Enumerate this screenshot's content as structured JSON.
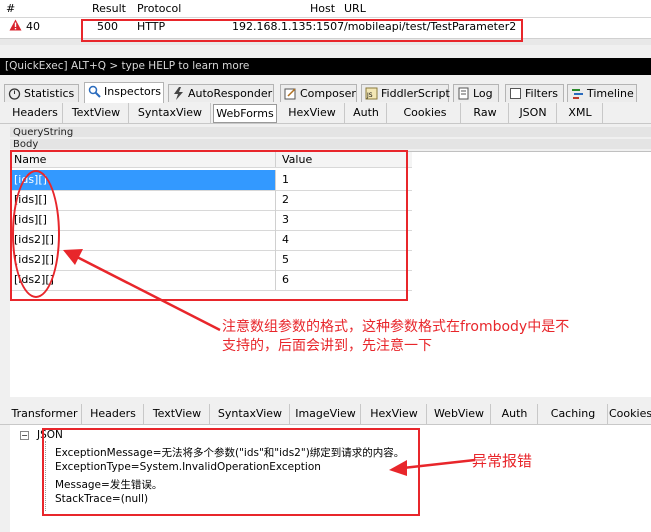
{
  "sessions": {
    "headers": [
      "#",
      "Result",
      "Protocol",
      "Host",
      "URL"
    ],
    "row": {
      "id": "40",
      "result": "500",
      "protocol": "HTTP",
      "host": "192.168.1.135:1507",
      "url": "/mobileapi/test/TestParameter2"
    }
  },
  "quickexec": {
    "placeholder": "[QuickExec] ALT+Q > type HELP to learn more"
  },
  "main_tabs": [
    "Statistics",
    "Inspectors",
    "AutoResponder",
    "Composer",
    "FiddlerScript",
    "Log",
    "Filters",
    "Timeline"
  ],
  "request_tabs": [
    "Headers",
    "TextView",
    "SyntaxView",
    "WebForms",
    "HexView",
    "Auth",
    "Cookies",
    "Raw",
    "JSON",
    "XML"
  ],
  "sections": {
    "querystring": "QueryString",
    "body": "Body"
  },
  "grid": {
    "columns": [
      "Name",
      "Value"
    ],
    "rows": [
      {
        "name": "[ids][]",
        "value": "1"
      },
      {
        "name": "[ids][]",
        "value": "2"
      },
      {
        "name": "[ids][]",
        "value": "3"
      },
      {
        "name": "[ids2][]",
        "value": "4"
      },
      {
        "name": "[ids2][]",
        "value": "5"
      },
      {
        "name": "[ids2][]",
        "value": "6"
      }
    ]
  },
  "annotations": {
    "note1_line1": "注意数组参数的格式，这种参数格式在frombody中是不",
    "note1_line2": "支持的，后面会讲到，先注意一下",
    "note2": "异常报错"
  },
  "response_tabs": [
    "Transformer",
    "Headers",
    "TextView",
    "SyntaxView",
    "ImageView",
    "HexView",
    "WebView",
    "Auth",
    "Caching",
    "Cookies"
  ],
  "tree": {
    "root": "JSON",
    "items": [
      "ExceptionMessage=无法将多个参数(\"ids\"和\"ids2\")绑定到请求的内容。",
      "ExceptionType=System.InvalidOperationException",
      "Message=发生错误。",
      "StackTrace=(null)"
    ]
  },
  "colors": {
    "annotation": "#e8262b",
    "selection": "#3399ff",
    "quickexec_bg": "#000000"
  }
}
